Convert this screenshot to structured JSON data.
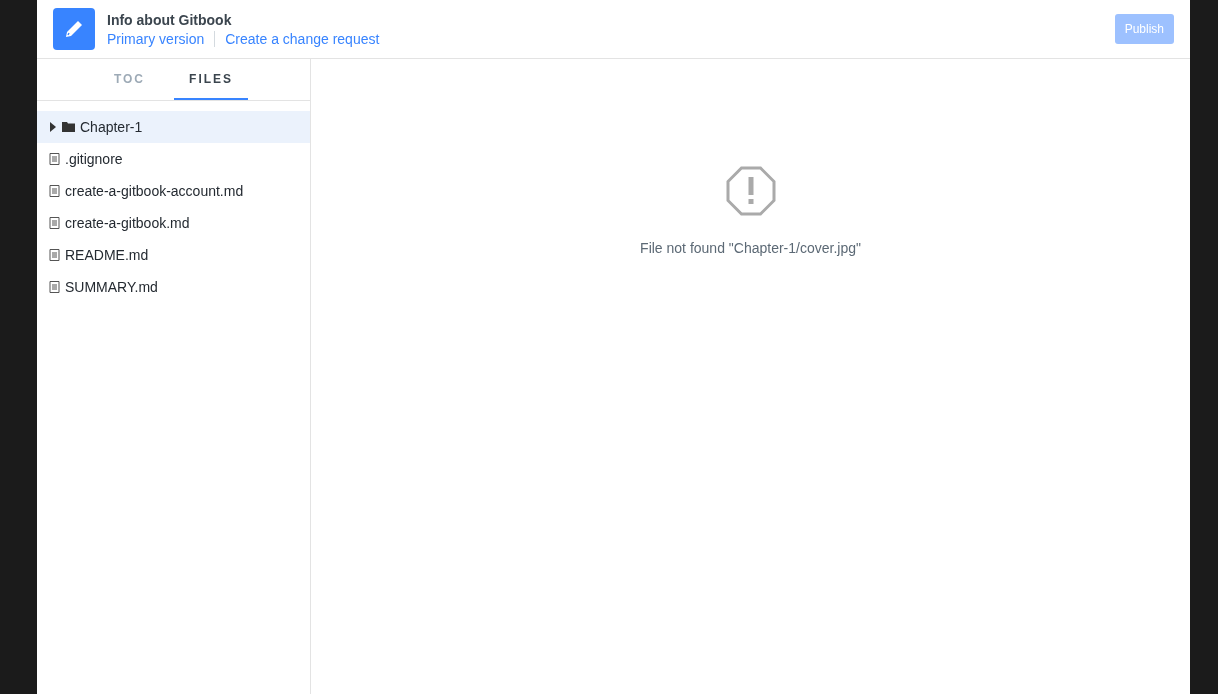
{
  "header": {
    "title": "Info about Gitbook",
    "links": [
      {
        "label": "Primary version"
      },
      {
        "label": "Create a change request"
      }
    ],
    "publish": {
      "label": "Publish",
      "disabled": true
    }
  },
  "tabs": [
    {
      "label": "TOC",
      "selected": false
    },
    {
      "label": "FILES",
      "selected": true
    }
  ],
  "files": [
    {
      "kind": "folder",
      "name": "Chapter-1",
      "selected": true,
      "expanded": false
    },
    {
      "kind": "file",
      "name": ".gitignore",
      "selected": false
    },
    {
      "kind": "file",
      "name": "create-a-gitbook-account.md",
      "selected": false
    },
    {
      "kind": "file",
      "name": "create-a-gitbook.md",
      "selected": false
    },
    {
      "kind": "file",
      "name": "README.md",
      "selected": false
    },
    {
      "kind": "file",
      "name": "SUMMARY.md",
      "selected": false
    }
  ],
  "message": "File not found \"Chapter-1/cover.jpg\""
}
